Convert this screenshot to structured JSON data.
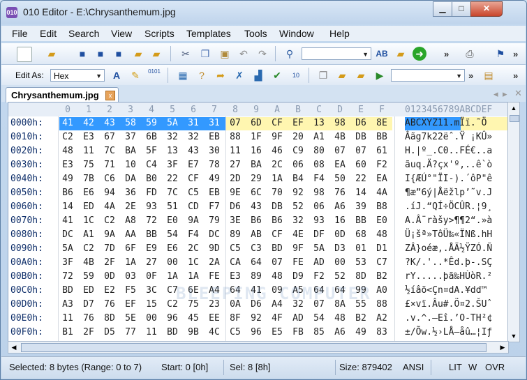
{
  "window": {
    "title": "010 Editor - E:\\Chrysanthemum.jpg",
    "minimize_icon": "minimize-icon",
    "maximize_icon": "maximize-icon",
    "close_icon": "close-icon"
  },
  "menu": [
    "File",
    "Edit",
    "Search",
    "View",
    "Scripts",
    "Templates",
    "Tools",
    "Window",
    "Help"
  ],
  "toolbar2": {
    "edit_as_label": "Edit As:",
    "edit_as_value": "Hex"
  },
  "tab": {
    "label": "Chrysanthemum.jpg"
  },
  "editor": {
    "hex_header": [
      "0",
      "1",
      "2",
      "3",
      "4",
      "5",
      "6",
      "7",
      "8",
      "9",
      "A",
      "B",
      "C",
      "D",
      "E",
      "F"
    ],
    "ascii_header": "0123456789ABCDEF",
    "rows": [
      {
        "addr": "0000h:",
        "hex": [
          "41",
          "42",
          "43",
          "58",
          "59",
          "5A",
          "31",
          "31",
          "07",
          "6D",
          "CF",
          "EF",
          "13",
          "98",
          "D6",
          "8E"
        ],
        "ascii": "ABCXYZ11.mÏï.˜Ö"
      },
      {
        "addr": "0010h:",
        "hex": [
          "C2",
          "E3",
          "67",
          "37",
          "6B",
          "32",
          "32",
          "EB",
          "88",
          "1F",
          "9F",
          "20",
          "A1",
          "4B",
          "DB",
          "BB"
        ],
        "ascii": "Âãg7k22ëˆ.Ÿ ¡KÛ»"
      },
      {
        "addr": "0020h:",
        "hex": [
          "48",
          "11",
          "7C",
          "BA",
          "5F",
          "13",
          "43",
          "30",
          "11",
          "16",
          "46",
          "C9",
          "80",
          "07",
          "07",
          "61"
        ],
        "ascii": "H.|º_.C0..FÉ€..a"
      },
      {
        "addr": "0030h:",
        "hex": [
          "E3",
          "75",
          "71",
          "10",
          "C4",
          "3F",
          "E7",
          "78",
          "27",
          "BA",
          "2C",
          "06",
          "08",
          "EA",
          "60",
          "F2"
        ],
        "ascii": "ãuq.Ä?çx'º,..ê`ò"
      },
      {
        "addr": "0040h:",
        "hex": [
          "49",
          "7B",
          "C6",
          "DA",
          "B0",
          "22",
          "CF",
          "49",
          "2D",
          "29",
          "1A",
          "B4",
          "F4",
          "50",
          "22",
          "EA"
        ],
        "ascii": "I{ÆÚ°\"ÏI-).´ôP\"ê"
      },
      {
        "addr": "0050h:",
        "hex": [
          "B6",
          "E6",
          "94",
          "36",
          "FD",
          "7C",
          "C5",
          "EB",
          "9E",
          "6C",
          "70",
          "92",
          "98",
          "76",
          "14",
          "4A"
        ],
        "ascii": "¶æ”6ý|Åëžlp’˜v.J"
      },
      {
        "addr": "0060h:",
        "hex": [
          "14",
          "ED",
          "4A",
          "2E",
          "93",
          "51",
          "CD",
          "F7",
          "D6",
          "43",
          "DB",
          "52",
          "06",
          "A6",
          "39",
          "B8"
        ],
        "ascii": ".íJ.“QÍ÷ÖCÛR.¦9¸"
      },
      {
        "addr": "0070h:",
        "hex": [
          "41",
          "1C",
          "C2",
          "A8",
          "72",
          "E0",
          "9A",
          "79",
          "3E",
          "B6",
          "B6",
          "32",
          "93",
          "16",
          "BB",
          "E0"
        ],
        "ascii": "A.Â¨ràšy>¶¶2“.»à"
      },
      {
        "addr": "0080h:",
        "hex": [
          "DC",
          "A1",
          "9A",
          "AA",
          "BB",
          "54",
          "F4",
          "DC",
          "89",
          "AB",
          "CF",
          "4E",
          "DF",
          "0D",
          "68",
          "48"
        ],
        "ascii": "Ü¡šª»TôÜ‰«ÏNß.hH"
      },
      {
        "addr": "0090h:",
        "hex": [
          "5A",
          "C2",
          "7D",
          "6F",
          "E9",
          "E6",
          "2C",
          "9D",
          "C5",
          "C3",
          "BD",
          "9F",
          "5A",
          "D3",
          "01",
          "D1"
        ],
        "ascii": "ZÂ}oéæ,.ÅÃ½ŸZÓ.Ñ"
      },
      {
        "addr": "00A0h:",
        "hex": [
          "3F",
          "4B",
          "2F",
          "1A",
          "27",
          "00",
          "1C",
          "2A",
          "CA",
          "64",
          "07",
          "FE",
          "AD",
          "00",
          "53",
          "C7"
        ],
        "ascii": "?K/.'..*Êd.þ-.SÇ"
      },
      {
        "addr": "00B0h:",
        "hex": [
          "72",
          "59",
          "0D",
          "03",
          "0F",
          "1A",
          "1A",
          "FE",
          "E3",
          "89",
          "48",
          "D9",
          "F2",
          "52",
          "8D",
          "B2"
        ],
        "ascii": "rY.....þã‰HÙòR.²"
      },
      {
        "addr": "00C0h:",
        "hex": [
          "BD",
          "ED",
          "E2",
          "F5",
          "3C",
          "C7",
          "6E",
          "A4",
          "64",
          "41",
          "09",
          "A5",
          "64",
          "64",
          "99",
          "A0"
        ],
        "ascii": "½íâõ<Çn¤dA.¥dd™ "
      },
      {
        "addr": "00D0h:",
        "hex": [
          "A3",
          "D7",
          "76",
          "EF",
          "15",
          "C2",
          "75",
          "23",
          "0A",
          "D6",
          "A4",
          "32",
          "07",
          "8A",
          "55",
          "88"
        ],
        "ascii": "£×vï.Âu#.Ö¤2.ŠUˆ"
      },
      {
        "addr": "00E0h:",
        "hex": [
          "11",
          "76",
          "8D",
          "5E",
          "00",
          "96",
          "45",
          "EE",
          "8F",
          "92",
          "4F",
          "AD",
          "54",
          "48",
          "B2",
          "A2"
        ],
        "ascii": ".v.^.–Eî.’O-TH²¢"
      },
      {
        "addr": "00F0h:",
        "hex": [
          "B1",
          "2F",
          "D5",
          "77",
          "11",
          "BD",
          "9B",
          "4C",
          "C5",
          "96",
          "E5",
          "FB",
          "85",
          "A6",
          "49",
          "83"
        ],
        "ascii": "±/Õw.½›LÅ–åû…¦Iƒ"
      }
    ]
  },
  "watermark": "BLEEPING COMPUTER",
  "status": {
    "selected": "Selected: 8 bytes (Range: 0 to 7)",
    "start": "Start: 0 [0h]",
    "sel": "Sel: 8 [8h]",
    "size": "Size: 879402",
    "encoding": "ANSI",
    "lit": "LIT",
    "w": "W",
    "ovr": "OVR"
  }
}
